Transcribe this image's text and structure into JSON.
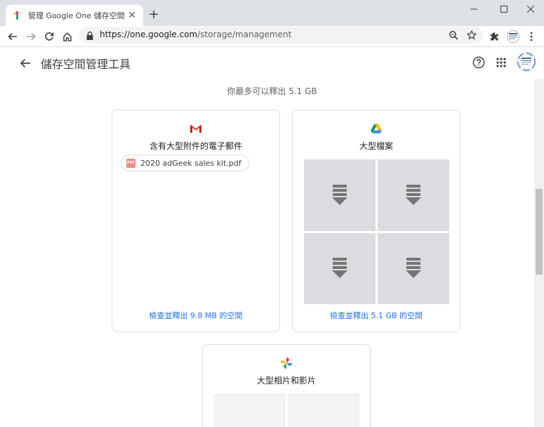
{
  "tab": {
    "title": "管理 Google One 儲存空間",
    "favicon": "google-one-favicon"
  },
  "window_buttons": [
    "minimize-icon",
    "maximize-icon",
    "close-icon"
  ],
  "address": {
    "host": "https://one.google.com",
    "path": "/storage/management"
  },
  "page": {
    "title": "儲存空間管理工具"
  },
  "summary": "你最多可以釋出 5.1 GB",
  "cards": {
    "gmail": {
      "title": "含有大型附件的電子郵件",
      "attachment": {
        "type": "PDF",
        "name": "2020 adGeek sales kit.pdf"
      },
      "link": "檢查並釋出 9.8 MB 的空間"
    },
    "drive": {
      "title": "大型檔案",
      "link": "檢查並釋出 5.1 GB 的空間"
    },
    "photos": {
      "title": "大型相片和影片"
    }
  },
  "colors": {
    "accent": "#1a73e8",
    "card_border": "#dadce0",
    "thumb_bg": "#dadce0",
    "gmail_red": "#ea4335"
  },
  "scroll": {
    "position_fraction": 0.42
  }
}
